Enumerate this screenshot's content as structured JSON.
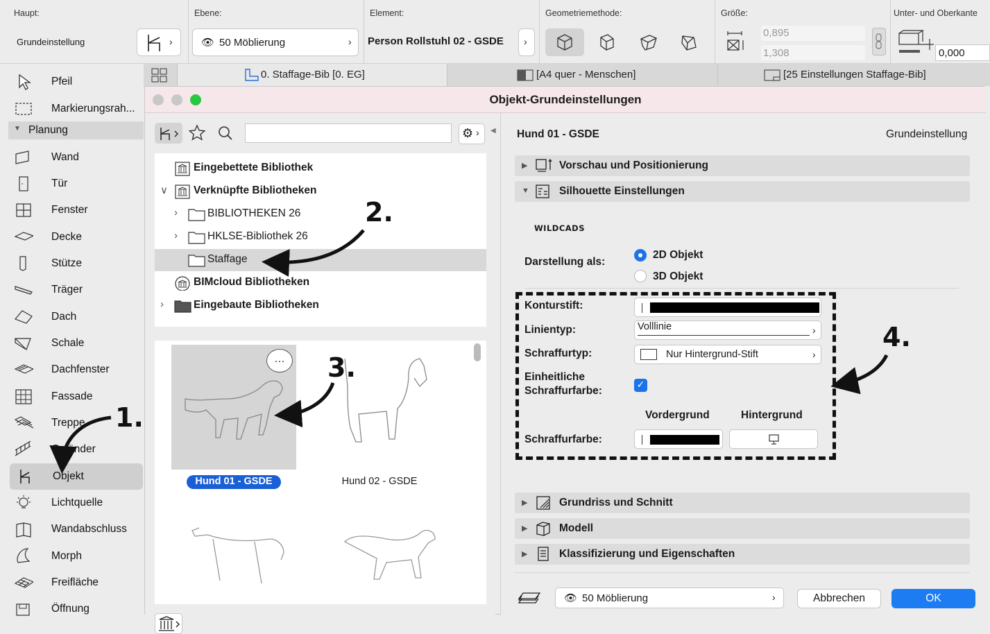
{
  "infobar": {
    "haupt_caption": "Haupt:",
    "haupt_value": "Grundeinstellung",
    "ebene_caption": "Ebene:",
    "ebene_value": "50 Möblierung",
    "element_caption": "Element:",
    "element_value": "Person Rollstuhl 02 - GSDE",
    "geometrie_caption": "Geometriemethode:",
    "groesse_caption": "Größe:",
    "groesse_a": "0,895",
    "groesse_b": "1,308",
    "unterober_caption": "Unter- und Oberkante",
    "unterober_value": "0,000"
  },
  "tabs": [
    {
      "label": "0. Staffage-Bib [0. EG]"
    },
    {
      "label": "[A4 quer - Menschen]"
    },
    {
      "label": "[25 Einstellungen Staffage-Bib]"
    }
  ],
  "toolbox": {
    "items": [
      {
        "label": "Pfeil",
        "icon": "arrow-pointer-icon"
      },
      {
        "label": "Markierungsrah...",
        "icon": "marquee-icon"
      },
      {
        "label": "Planung",
        "icon": "disclosure-triangle-icon",
        "group": true
      },
      {
        "label": "Wand",
        "icon": "wall-icon"
      },
      {
        "label": "Tür",
        "icon": "door-icon"
      },
      {
        "label": "Fenster",
        "icon": "window-icon"
      },
      {
        "label": "Decke",
        "icon": "slab-icon"
      },
      {
        "label": "Stütze",
        "icon": "column-icon"
      },
      {
        "label": "Träger",
        "icon": "beam-icon"
      },
      {
        "label": "Dach",
        "icon": "roof-icon"
      },
      {
        "label": "Schale",
        "icon": "shell-icon"
      },
      {
        "label": "Dachfenster",
        "icon": "skylight-icon"
      },
      {
        "label": "Fassade",
        "icon": "curtain-wall-icon"
      },
      {
        "label": "Treppe",
        "icon": "stair-icon"
      },
      {
        "label": "Geländer",
        "icon": "railing-icon"
      },
      {
        "label": "Objekt",
        "icon": "object-chair-icon",
        "selected": true
      },
      {
        "label": "Lichtquelle",
        "icon": "lamp-icon"
      },
      {
        "label": "Wandabschluss",
        "icon": "wall-end-icon"
      },
      {
        "label": "Morph",
        "icon": "morph-icon"
      },
      {
        "label": "Freifläche",
        "icon": "mesh-icon"
      },
      {
        "label": "Öffnung",
        "icon": "opening-icon"
      }
    ]
  },
  "dialog": {
    "title": "Objekt-Grundeinstellungen",
    "library_tree": [
      {
        "label": "Eingebettete Bibliothek",
        "bold": true
      },
      {
        "label": "Verknüpfte Bibliotheken",
        "bold": true
      },
      {
        "label": "BIBLIOTHEKEN 26",
        "bold": false
      },
      {
        "label": "HKLSE-Bibliothek 26",
        "bold": false
      },
      {
        "label": "Staffage",
        "bold": false,
        "selected": true
      },
      {
        "label": "BIMcloud Bibliotheken",
        "bold": true
      },
      {
        "label": "Eingebaute Bibliotheken",
        "bold": true
      }
    ],
    "objects": [
      {
        "label": "Hund 01 - GSDE",
        "selected": true
      },
      {
        "label": "Hund 02 - GSDE",
        "selected": false
      },
      {
        "label": "",
        "selected": false
      },
      {
        "label": "",
        "selected": false
      }
    ],
    "more_button": "…",
    "right": {
      "object_name": "Hund 01 - GSDE",
      "default_label": "Grundeinstellung",
      "sections": {
        "vorschau": "Vorschau und Positionierung",
        "silhouette": "Silhouette Einstellungen",
        "grundriss": "Grundriss und Schnitt",
        "modell": "Modell",
        "klassifizierung": "Klassifizierung und Eigenschaften"
      },
      "logo": "WILDCADS",
      "darstellung_label": "Darstellung als:",
      "opt_2d": "2D Objekt",
      "opt_3d": "3D Objekt",
      "konturstift_label": "Konturstift:",
      "linientyp_label": "Linientyp:",
      "linientyp_value": "Volllinie",
      "schraffurtyp_label": "Schraffurtyp:",
      "schraffurtyp_value": "Nur Hintergrund-Stift",
      "einheitlich_label_1": "Einheitliche",
      "einheitlich_label_2": "Schraffurfarbe:",
      "vordergrund": "Vordergrund",
      "hintergrund": "Hintergrund",
      "schraffurfarbe_label": "Schraffurfarbe:",
      "ebene_value": "50 Möblierung",
      "cancel": "Abbrechen",
      "ok": "OK"
    }
  },
  "annotations": [
    "1.",
    "2.",
    "3.",
    "4."
  ],
  "colors": {
    "accent": "#1a73e8",
    "ok": "#1e7cf2",
    "titlebar": "#f6e8ea"
  }
}
